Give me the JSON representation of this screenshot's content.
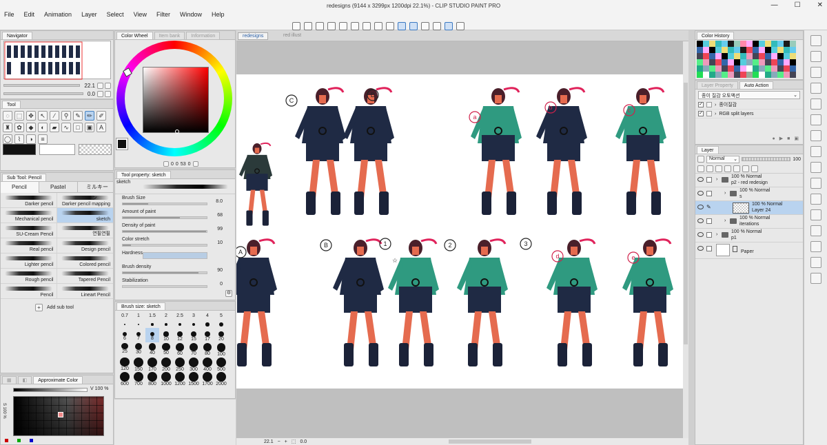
{
  "window": {
    "title": "redesigns (9144 x 3299px 1200dpi 22.1%) - CLIP STUDIO PAINT PRO",
    "controls": [
      "—",
      "☐",
      "✕"
    ]
  },
  "menu": [
    "File",
    "Edit",
    "Animation",
    "Layer",
    "Select",
    "View",
    "Filter",
    "Window",
    "Help"
  ],
  "navigator": {
    "tab": "Navigator",
    "zoom": "22.1",
    "rotation": "0.0"
  },
  "color_wheel": {
    "tabs": [
      "Color Wheel",
      "Item bank",
      "Information"
    ],
    "values": [
      "0",
      "0",
      "53",
      "0"
    ],
    "main_color": "#111111"
  },
  "tool_panel": {
    "tab": "Tool"
  },
  "subtool": {
    "tab": "Sub Tool: Pencil",
    "groups": [
      "Pencil",
      "Pastel",
      "ミルキーペン"
    ],
    "brushes": [
      [
        "Darker pencil",
        "Darker pencil mapping"
      ],
      [
        "Mechanical pencil",
        "sketch"
      ],
      [
        "SU-Cream Pencil",
        "연필연필"
      ],
      [
        "Real pencil",
        "Design pencil"
      ],
      [
        "Lighter pencil",
        "Colored pencil"
      ],
      [
        "Rough pencil",
        "Tapered Pencil"
      ],
      [
        "Pencil",
        "Lineart Pencil"
      ]
    ],
    "add_label": "Add sub tool"
  },
  "tool_property": {
    "tab": "Tool property: sketch",
    "name": "sketch",
    "props": [
      {
        "label": "Brush Size",
        "value": "8.0",
        "pct": 0.3
      },
      {
        "label": "Amount of paint",
        "value": "68",
        "pct": 0.68
      },
      {
        "label": "Density of paint",
        "value": "99",
        "pct": 0.99
      },
      {
        "label": "Color stretch",
        "value": "10",
        "pct": 0.1
      },
      {
        "label": "Hardness",
        "value": "",
        "pct": 1.0
      },
      {
        "label": "Brush density",
        "value": "90",
        "pct": 0.9
      },
      {
        "label": "Stabilization",
        "value": "0",
        "pct": 0.0
      }
    ]
  },
  "brush_size": {
    "tab": "Brush size: sketch",
    "sizes": [
      "0.7",
      "1",
      "1.5",
      "2",
      "2.5",
      "3",
      "4",
      "5",
      "6",
      "7",
      "8",
      "10",
      "12",
      "15",
      "17",
      "20",
      "25",
      "30",
      "40",
      "50",
      "60",
      "70",
      "80",
      "100",
      "120",
      "150",
      "170",
      "200",
      "250",
      "300",
      "400",
      "500",
      "600",
      "700",
      "800",
      "1000",
      "1200",
      "1500",
      "1700",
      "2000"
    ],
    "selected": "8"
  },
  "approx_color": {
    "tabs": [
      "Approximate Color"
    ],
    "v_value": "V 100 %",
    "s_value": "S 100 %"
  },
  "canvas": {
    "tabs": [
      "redesigns",
      "red illust"
    ],
    "zoom": "22.1",
    "angle": "0.0"
  },
  "sketch_labels": [
    "C",
    "D",
    "a",
    "b",
    "c",
    "A",
    "B",
    "1",
    "☆",
    "2",
    "3",
    "d",
    "e"
  ],
  "color_history": {
    "tab": "Color History"
  },
  "auto_action": {
    "tabs": [
      "Layer Property",
      "Auto Action"
    ],
    "set": "종이 질감 오토액션",
    "items": [
      "종이질감",
      "RGB split layers"
    ]
  },
  "layer": {
    "tabs": [
      "Layer"
    ],
    "blend": "Normal",
    "opacity": "100",
    "rows": [
      {
        "line1": "100 % Normal",
        "line2": "p2 - red redesign",
        "indent": 0,
        "folder": true
      },
      {
        "line1": "100 % Normal",
        "line2": "s",
        "indent": 1,
        "folder": true
      },
      {
        "line1": "100 % Normal",
        "line2": "Layer 24",
        "indent": 2,
        "folder": false,
        "selected": true
      },
      {
        "line1": "100 % Normal",
        "line2": "iterations",
        "indent": 1,
        "folder": true
      },
      {
        "line1": "100 % Normal",
        "line2": "p1",
        "indent": 0,
        "folder": true
      },
      {
        "line1": "",
        "line2": "Paper",
        "indent": 0,
        "folder": false,
        "paper": true
      }
    ]
  },
  "colors": {
    "accent": "#3a78c2",
    "selection": "#b9d3ef",
    "navy_outfit": "#1f2a44",
    "teal_outfit": "#2f9a80",
    "skin": "#e56b4f",
    "hair_accent": "#e0235b"
  }
}
